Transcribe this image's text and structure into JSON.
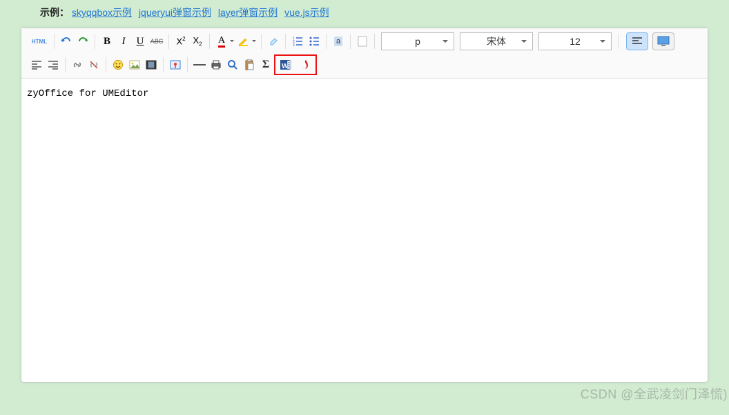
{
  "header": {
    "label": "示例：",
    "links": [
      {
        "text": "skyqqbox示例"
      },
      {
        "text": "jqueryui弹窗示例"
      },
      {
        "text": "layer弹窗示例"
      },
      {
        "text": "vue.js示例"
      }
    ]
  },
  "toolbar": {
    "html": "HTML",
    "para_value": "p",
    "font_value": "宋体",
    "size_value": "12",
    "icons": {
      "undo_color": "#2e7cd6",
      "redo_color": "#2d9a3d",
      "bold": "B",
      "italic": "I",
      "underline": "U",
      "strike": "ABC",
      "sup": "X",
      "sub": "X",
      "fontA": "A",
      "eraser_color": "#6bb4f0",
      "link_color": "#888",
      "anchor_color": "#888",
      "emoji_color": "#f0b000",
      "image_border": "#b8b070",
      "video_border": "#555",
      "map_border": "#3b7dd8",
      "hr_color": "#555",
      "print_color": "#333",
      "preview_color": "#3070c0",
      "paste_color": "#c89050",
      "formula": "Σ",
      "word_fill": "#2b579a",
      "pdf_fill": "#d21f1f",
      "highlight_border": "#fc0"
    }
  },
  "editor": {
    "content": "zyOffice for UMEditor"
  },
  "watermark": "CSDN @全武凌剑门泽慌)"
}
